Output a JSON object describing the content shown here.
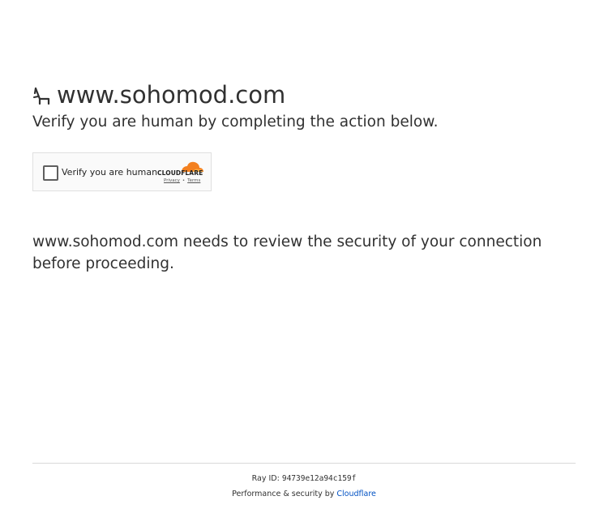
{
  "header": {
    "favicon": "chair-icon",
    "site": "www.sohomod.com",
    "subtitle": "Verify you are human by completing the action below."
  },
  "challenge": {
    "checkbox_label": "Verify you are human",
    "brand": "CLOUDFLARE",
    "privacy_label": "Privacy",
    "separator": "•",
    "terms_label": "Terms",
    "brand_color": "#f38020"
  },
  "message": "www.sohomod.com needs to review the security of your connection before proceeding.",
  "footer": {
    "ray_label": "Ray ID:",
    "ray_id": "94739e12a94c159f",
    "performance_text": "Performance & security by",
    "provider_link": "Cloudflare",
    "link_color": "#0051c3"
  }
}
